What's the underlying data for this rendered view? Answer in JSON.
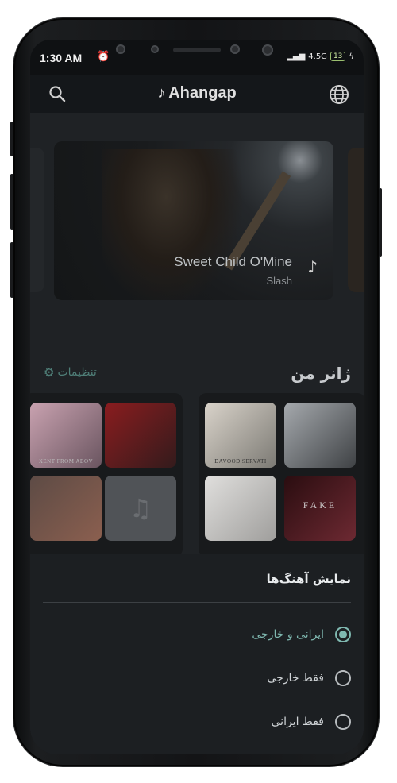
{
  "status_bar": {
    "time": "1:30 AM",
    "network": "4.5G",
    "battery": "13"
  },
  "app_bar": {
    "brand": "Ahangap",
    "left_icon": "search-icon",
    "right_icon": "globe-icon"
  },
  "hero": {
    "title": "Sweet Child O'Mine",
    "artist": "Slash",
    "icon": "music-note-icon"
  },
  "genre_section": {
    "title": "ژانر من",
    "settings_label": "تنظیمات",
    "left_card_tiles": [
      {
        "caption": "XENT FROM ABOV",
        "colors": [
          "#8d6c78",
          "#caa6a6"
        ]
      },
      {
        "caption": "",
        "colors": [
          "#7a1d1f",
          "#3b3b3d"
        ]
      },
      {
        "caption": "",
        "colors": [
          "#4a3f3b",
          "#7b6964"
        ]
      },
      {
        "caption": "",
        "colors": [
          "#4b4e52",
          "#5a5d61"
        ],
        "placeholder_icon": "music-note-icon"
      }
    ],
    "right_card_tiles": [
      {
        "caption": "DAVOOD SERVATI",
        "colors": [
          "#cbc6be",
          "#7a7872"
        ]
      },
      {
        "caption": "",
        "colors": [
          "#9a9ea2",
          "#4a4c50"
        ]
      },
      {
        "caption": "",
        "colors": [
          "#d9d8d6",
          "#a9a8a6"
        ]
      },
      {
        "caption": "FAKE",
        "colors": [
          "#2d0f12",
          "#6a2a33"
        ]
      }
    ]
  },
  "sheet": {
    "title": "نمایش آهنگ‌ها",
    "options": [
      {
        "label": "ایرانی و خارجی",
        "selected": true
      },
      {
        "label": "فقط خارجی",
        "selected": false
      },
      {
        "label": "فقط ایرانی",
        "selected": false
      }
    ]
  },
  "colors": {
    "accent": "#7fb8b0",
    "background": "#1f2225",
    "sheet": "#1c1f22"
  }
}
